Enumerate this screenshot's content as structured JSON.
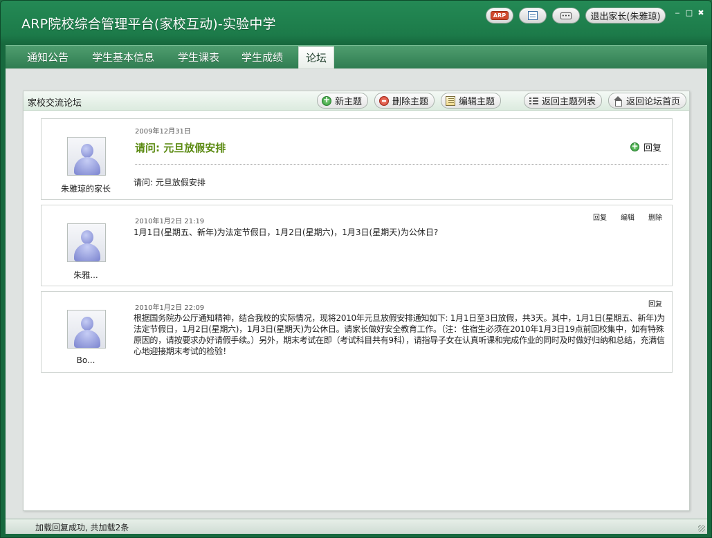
{
  "app": {
    "title": "ARP院校综合管理平台(家校互动)-实验中学",
    "logout_label": "退出家长(朱雅琼)",
    "arp_badge": "ARP",
    "msg_glyph": "•••",
    "win_min": "‒",
    "win_max": "□",
    "win_close": "✖"
  },
  "nav": {
    "tabs": [
      {
        "label": "通知公告"
      },
      {
        "label": "学生基本信息"
      },
      {
        "label": "学生课表"
      },
      {
        "label": "学生成绩"
      },
      {
        "label": "论坛",
        "active": true
      }
    ]
  },
  "forum": {
    "title": "家校交流论坛",
    "toolbar": {
      "new_topic": "新主题",
      "delete_topic": "删除主题",
      "edit_topic": "编辑主题",
      "back_to_list": "返回主题列表",
      "back_to_home": "返回论坛首页"
    },
    "topic": {
      "author": "朱雅琼的家长",
      "date": "2009年12月31日",
      "title": "请问: 元旦放假安排",
      "reply_label": "回复",
      "body": "请问: 元旦放假安排"
    },
    "replies": [
      {
        "author": "朱雅...",
        "date": "2010年1月2日 21:19",
        "body": "1月1日(星期五、新年)为法定节假日，1月2日(星期六)，1月3日(星期天)为公休日?",
        "actions": {
          "reply": "回复",
          "edit": "编辑",
          "delete": "删除"
        }
      },
      {
        "author": "Bo...",
        "date": "2010年1月2日 22:09",
        "body": "根据国务院办公厅通知精神，结合我校的实际情况，现将2010年元旦放假安排通知如下: 1月1日至3日放假，共3天。其中，1月1日(星期五、新年)为法定节假日，1月2日(星期六)，1月3日(星期天)为公休日。请家长做好安全教育工作。（注：住宿生必须在2010年1月3日19点前回校集中，如有特殊原因的，请按要求办好请假手续。）另外，期末考试在即（考试科目共有9科），请指导子女在认真听课和完成作业的同时及时做好归纳和总结，充满信心地迎接期末考试的检验！",
        "actions": {
          "reply": "回复"
        }
      }
    ]
  },
  "status": {
    "text": "加载回复成功, 共加载2条"
  },
  "colors": {
    "titlebar": "#1c7a49",
    "topic_title": "#5b8a12",
    "panel_header": "#dcebdf"
  }
}
